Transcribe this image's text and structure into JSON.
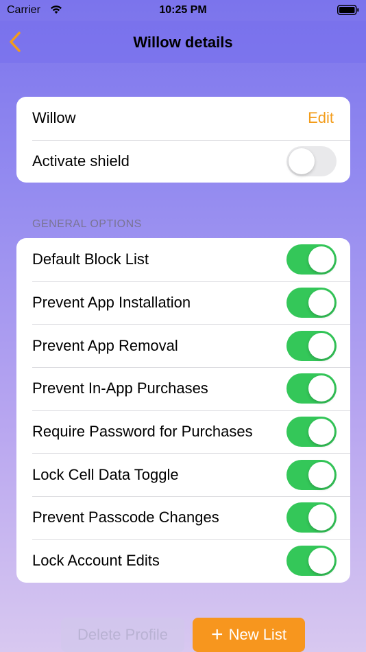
{
  "status_bar": {
    "carrier": "Carrier",
    "time": "10:25 PM"
  },
  "nav": {
    "title": "Willow details",
    "back_icon": "chevron-left-icon"
  },
  "profile_card": {
    "name": "Willow",
    "edit_label": "Edit",
    "shield_label": "Activate shield",
    "shield_on": false
  },
  "general": {
    "header": "GENERAL OPTIONS",
    "options": [
      {
        "label": "Default Block List",
        "on": true
      },
      {
        "label": "Prevent App Installation",
        "on": true
      },
      {
        "label": "Prevent App Removal",
        "on": true
      },
      {
        "label": "Prevent In-App Purchases",
        "on": true
      },
      {
        "label": "Require Password for Purchases",
        "on": true
      },
      {
        "label": "Lock Cell Data Toggle",
        "on": true
      },
      {
        "label": "Prevent Passcode Changes",
        "on": true
      },
      {
        "label": "Lock Account Edits",
        "on": true
      }
    ]
  },
  "footer": {
    "delete_label": "Delete Profile",
    "new_list_label": "New List"
  },
  "colors": {
    "accent": "#f7961e",
    "toggle_on": "#34c759",
    "toggle_off": "#e9e9eb"
  }
}
